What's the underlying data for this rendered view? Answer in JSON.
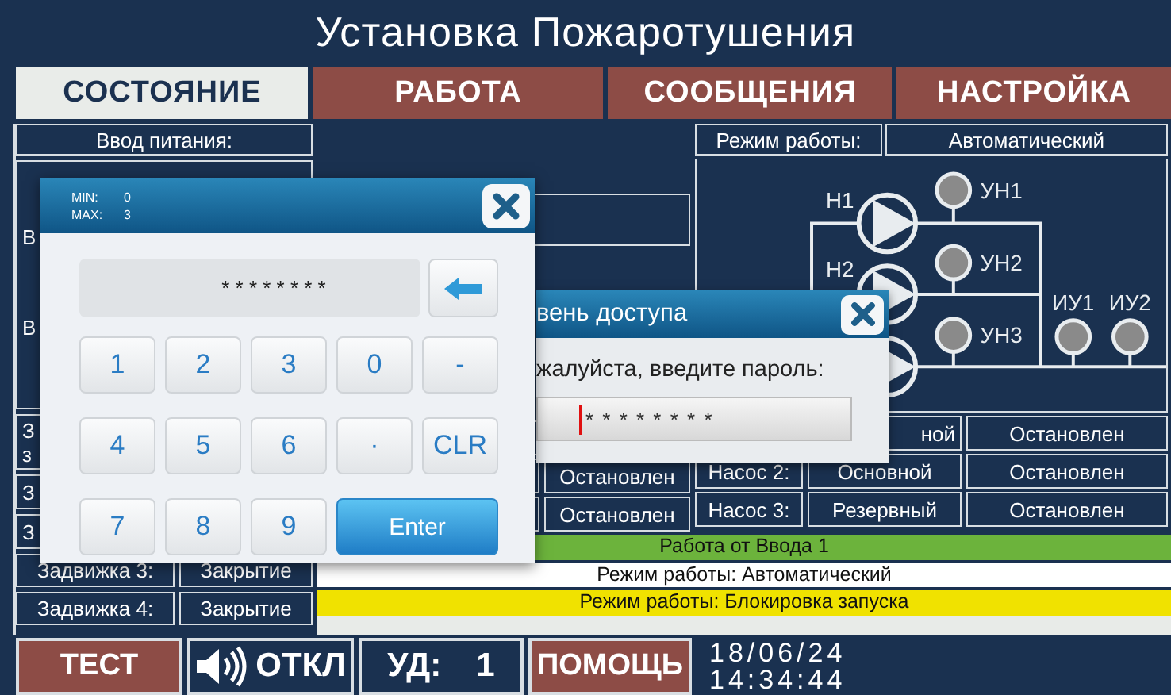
{
  "title": "Установка Пожаротушения",
  "tabs": [
    {
      "label": "СОСТОЯНИЕ",
      "selected": true
    },
    {
      "label": "РАБОТА",
      "selected": false
    },
    {
      "label": "СООБЩЕНИЯ",
      "selected": false
    },
    {
      "label": "НАСТРОЙКА",
      "selected": false
    }
  ],
  "power_panel": {
    "header": "Ввод питания:",
    "lines": [
      "В",
      "В"
    ]
  },
  "valves": [
    {
      "lines": [
        "З",
        "з"
      ]
    },
    {
      "lines": [
        "З"
      ]
    },
    {
      "lines": [
        "З"
      ]
    },
    {
      "lines": [
        "Задвижка 3:"
      ],
      "value": "Закрытие"
    },
    {
      "lines": [
        "Задвижка 4:"
      ],
      "value": "Закрытие"
    }
  ],
  "middle_values": [
    "Остановлен",
    "Остановлен"
  ],
  "mode": {
    "label": "Режим работы:",
    "value": "Автоматический"
  },
  "diagram": {
    "pump_labels": [
      "Н1",
      "Н2"
    ],
    "valve_lamps": [
      {
        "label": "УН1",
        "on": false
      },
      {
        "label": "УН2",
        "on": false
      },
      {
        "label": "УН3",
        "on": false
      }
    ],
    "output_lamps": [
      {
        "label": "ИУ1",
        "on": false
      },
      {
        "label": "ИУ2",
        "on": false
      }
    ]
  },
  "pumps": [
    {
      "role": "ной",
      "status": "Остановлен"
    },
    {
      "name": "Насос 2:",
      "role": "Основной",
      "status": "Остановлен"
    },
    {
      "name": "Насос 3:",
      "role": "Резервный",
      "status": "Остановлен"
    }
  ],
  "status_bars": [
    {
      "text": "Работа от Ввода 1",
      "color": "#6cb33c"
    },
    {
      "text": "Режим работы: Автоматический",
      "color": "#ffffff"
    },
    {
      "text": "Режим работы: Блокировка запуска",
      "color": "#f0e200"
    }
  ],
  "bottom_bar": {
    "buttons": [
      {
        "kind": "alert",
        "label": "ТЕСТ"
      },
      {
        "kind": "sound",
        "label": "ОТКЛ"
      },
      {
        "kind": "info",
        "label": "УД:",
        "value": "1"
      },
      {
        "kind": "alert",
        "label": "ПОМОЩЬ"
      }
    ],
    "date": "18/06/24",
    "time": "14:34:44"
  },
  "access_dialog": {
    "title": "вень доступа",
    "prompt": "жалуйста, введите пароль:",
    "value": "* * * * * * * *"
  },
  "keypad": {
    "min_label": "MIN:",
    "min": "0",
    "max_label": "MAX:",
    "max": "3",
    "display": "* * * * * * * *",
    "keys": [
      {
        "label": "1",
        "kind": "key"
      },
      {
        "label": "2",
        "kind": "key"
      },
      {
        "label": "3",
        "kind": "key"
      },
      {
        "label": "0",
        "kind": "key"
      },
      {
        "label": "-",
        "kind": "key"
      },
      {
        "label": "4",
        "kind": "key"
      },
      {
        "label": "5",
        "kind": "key"
      },
      {
        "label": "6",
        "kind": "key"
      },
      {
        "label": "·",
        "kind": "key"
      },
      {
        "label": "CLR",
        "kind": "key"
      },
      {
        "label": "7",
        "kind": "key"
      },
      {
        "label": "8",
        "kind": "key"
      },
      {
        "label": "9",
        "kind": "key"
      },
      {
        "label": "Enter",
        "kind": "enter"
      }
    ]
  }
}
